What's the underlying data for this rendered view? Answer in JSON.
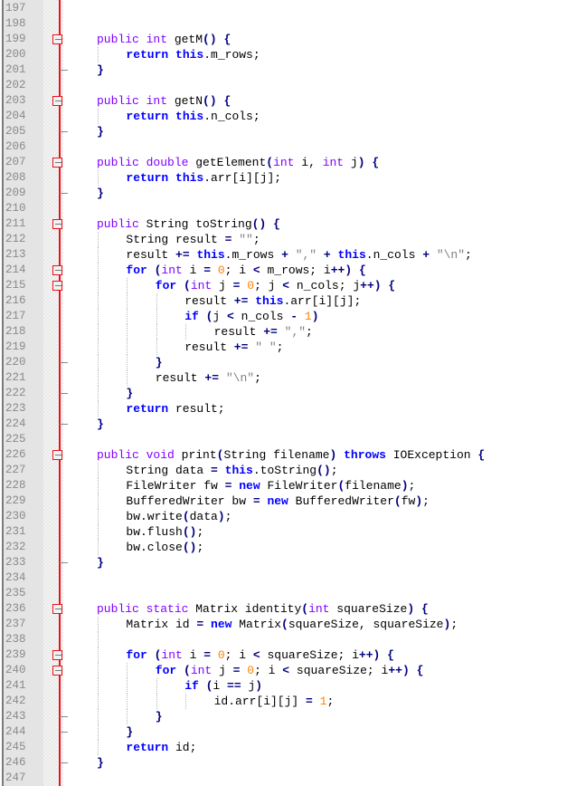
{
  "editor": {
    "language": "java",
    "colors": {
      "keyword": "#0000ff",
      "type": "#8000ff",
      "number": "#ff8000",
      "string": "#808080",
      "operator": "#000080",
      "fold_line": "#e8141c",
      "gutter_bg": "#e4e4e4",
      "line_number": "#8a8a8a"
    },
    "lines": [
      {
        "n": "197",
        "fold": "none",
        "indent": 0,
        "text": ""
      },
      {
        "n": "198",
        "fold": "none",
        "indent": 0,
        "text": ""
      },
      {
        "n": "199",
        "fold": "open",
        "indent": 1,
        "text": "public int getM() {"
      },
      {
        "n": "200",
        "fold": "none",
        "indent": 2,
        "text": "return this.m_rows;"
      },
      {
        "n": "201",
        "fold": "end",
        "indent": 1,
        "text": "}"
      },
      {
        "n": "202",
        "fold": "none",
        "indent": 0,
        "text": ""
      },
      {
        "n": "203",
        "fold": "open",
        "indent": 1,
        "text": "public int getN() {"
      },
      {
        "n": "204",
        "fold": "none",
        "indent": 2,
        "text": "return this.n_cols;"
      },
      {
        "n": "205",
        "fold": "end",
        "indent": 1,
        "text": "}"
      },
      {
        "n": "206",
        "fold": "none",
        "indent": 0,
        "text": ""
      },
      {
        "n": "207",
        "fold": "open",
        "indent": 1,
        "text": "public double getElement(int i, int j) {"
      },
      {
        "n": "208",
        "fold": "none",
        "indent": 2,
        "text": "return this.arr[i][j];"
      },
      {
        "n": "209",
        "fold": "end",
        "indent": 1,
        "text": "}"
      },
      {
        "n": "210",
        "fold": "none",
        "indent": 0,
        "text": ""
      },
      {
        "n": "211",
        "fold": "open",
        "indent": 1,
        "text": "public String toString() {"
      },
      {
        "n": "212",
        "fold": "none",
        "indent": 2,
        "text": "String result = \"\";"
      },
      {
        "n": "213",
        "fold": "none",
        "indent": 2,
        "text": "result += this.m_rows + \",\" + this.n_cols + \"\\n\";"
      },
      {
        "n": "214",
        "fold": "open",
        "indent": 2,
        "text": "for (int i = 0; i < m_rows; i++) {"
      },
      {
        "n": "215",
        "fold": "open",
        "indent": 3,
        "text": "for (int j = 0; j < n_cols; j++) {"
      },
      {
        "n": "216",
        "fold": "none",
        "indent": 4,
        "text": "result += this.arr[i][j];"
      },
      {
        "n": "217",
        "fold": "none",
        "indent": 4,
        "text": "if (j < n_cols - 1)"
      },
      {
        "n": "218",
        "fold": "none",
        "indent": 5,
        "text": "result += \",\";"
      },
      {
        "n": "219",
        "fold": "none",
        "indent": 4,
        "text": "result += \" \";"
      },
      {
        "n": "220",
        "fold": "end",
        "indent": 3,
        "text": "}"
      },
      {
        "n": "221",
        "fold": "none",
        "indent": 3,
        "text": "result += \"\\n\";"
      },
      {
        "n": "222",
        "fold": "end",
        "indent": 2,
        "text": "}"
      },
      {
        "n": "223",
        "fold": "none",
        "indent": 2,
        "text": "return result;"
      },
      {
        "n": "224",
        "fold": "end",
        "indent": 1,
        "text": "}"
      },
      {
        "n": "225",
        "fold": "none",
        "indent": 0,
        "text": ""
      },
      {
        "n": "226",
        "fold": "open",
        "indent": 1,
        "text": "public void print(String filename) throws IOException {"
      },
      {
        "n": "227",
        "fold": "none",
        "indent": 2,
        "text": "String data = this.toString();"
      },
      {
        "n": "228",
        "fold": "none",
        "indent": 2,
        "text": "FileWriter fw = new FileWriter(filename);"
      },
      {
        "n": "229",
        "fold": "none",
        "indent": 2,
        "text": "BufferedWriter bw = new BufferedWriter(fw);"
      },
      {
        "n": "230",
        "fold": "none",
        "indent": 2,
        "text": "bw.write(data);"
      },
      {
        "n": "231",
        "fold": "none",
        "indent": 2,
        "text": "bw.flush();"
      },
      {
        "n": "232",
        "fold": "none",
        "indent": 2,
        "text": "bw.close();"
      },
      {
        "n": "233",
        "fold": "end",
        "indent": 1,
        "text": "}"
      },
      {
        "n": "234",
        "fold": "none",
        "indent": 0,
        "text": ""
      },
      {
        "n": "235",
        "fold": "none",
        "indent": 0,
        "text": ""
      },
      {
        "n": "236",
        "fold": "open",
        "indent": 1,
        "text": "public static Matrix identity(int squareSize) {"
      },
      {
        "n": "237",
        "fold": "none",
        "indent": 2,
        "text": "Matrix id = new Matrix(squareSize, squareSize);"
      },
      {
        "n": "238",
        "fold": "none",
        "indent": 0,
        "text": ""
      },
      {
        "n": "239",
        "fold": "open",
        "indent": 2,
        "text": "for (int i = 0; i < squareSize; i++) {"
      },
      {
        "n": "240",
        "fold": "open",
        "indent": 3,
        "text": "for (int j = 0; i < squareSize; i++) {"
      },
      {
        "n": "241",
        "fold": "none",
        "indent": 4,
        "text": "if (i == j)"
      },
      {
        "n": "242",
        "fold": "none",
        "indent": 5,
        "text": "id.arr[i][j] = 1;"
      },
      {
        "n": "243",
        "fold": "end",
        "indent": 3,
        "text": "}"
      },
      {
        "n": "244",
        "fold": "end",
        "indent": 2,
        "text": "}"
      },
      {
        "n": "245",
        "fold": "none",
        "indent": 2,
        "text": "return id;"
      },
      {
        "n": "246",
        "fold": "end",
        "indent": 1,
        "text": "}"
      },
      {
        "n": "247",
        "fold": "none",
        "indent": 0,
        "text": ""
      }
    ]
  }
}
